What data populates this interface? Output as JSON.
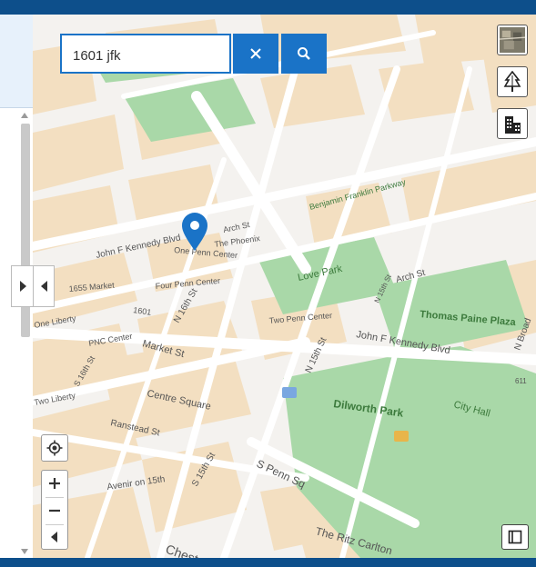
{
  "search": {
    "value": "1601 jfk"
  },
  "map": {
    "labels": {
      "north_broad": "N Broad St",
      "arch_st_top": "Arch St",
      "jfk_left": "John F Kennedy Blvd",
      "jfk_right": "John F Kennedy Blvd",
      "arch_st_right": "Arch St",
      "market_st": "Market St",
      "n16th": "N 16th St",
      "n15th": "N 15th St",
      "n15th_short": "N 15th St",
      "s15th": "S 15th St",
      "s16th": "S 16th St",
      "n_broad_right": "N Broad",
      "ranstead": "Ranstead St",
      "s_penn_sq": "S Penn Sq",
      "chestnut": "Chest",
      "love_park": "Love Park",
      "thomas_paine": "Thomas Paine Plaza",
      "dilworth": "Dilworth Park",
      "city_hall": "City Hall",
      "benjamin_franklin": "Benjamin Franklin Parkway",
      "one_penn": "One Penn Center",
      "two_penn": "Two Penn Center",
      "four_penn": "Four Penn Center",
      "the_phoenix": "The Phoenix",
      "pnc_center": "PNC Center",
      "centre_square": "Centre Square",
      "avenir": "Avenir on 15th",
      "ritz": "The Ritz Carlton",
      "num_1601": "1601",
      "num_1655": "1655 Market",
      "one_liberty": "One Liberty",
      "two_liberty": "Two Liberty",
      "route_611": "611"
    }
  },
  "colors": {
    "header": "#0d4f8b",
    "accent": "#1a73c7",
    "building": "#f3dfc1",
    "park": "#a9d8a8",
    "road": "#ffffff",
    "marker": "#1a73c7"
  },
  "icons": {
    "clear": "close-icon",
    "search": "search-icon",
    "basemap": "satellite-thumbnail-icon",
    "trees": "tree-layer-icon",
    "buildings": "building-layer-icon",
    "locate": "crosshair-icon",
    "zoom_in": "plus-icon",
    "zoom_out": "minus-icon",
    "compass": "compass-icon",
    "legend": "legend-icon",
    "marker": "map-pin-icon"
  }
}
